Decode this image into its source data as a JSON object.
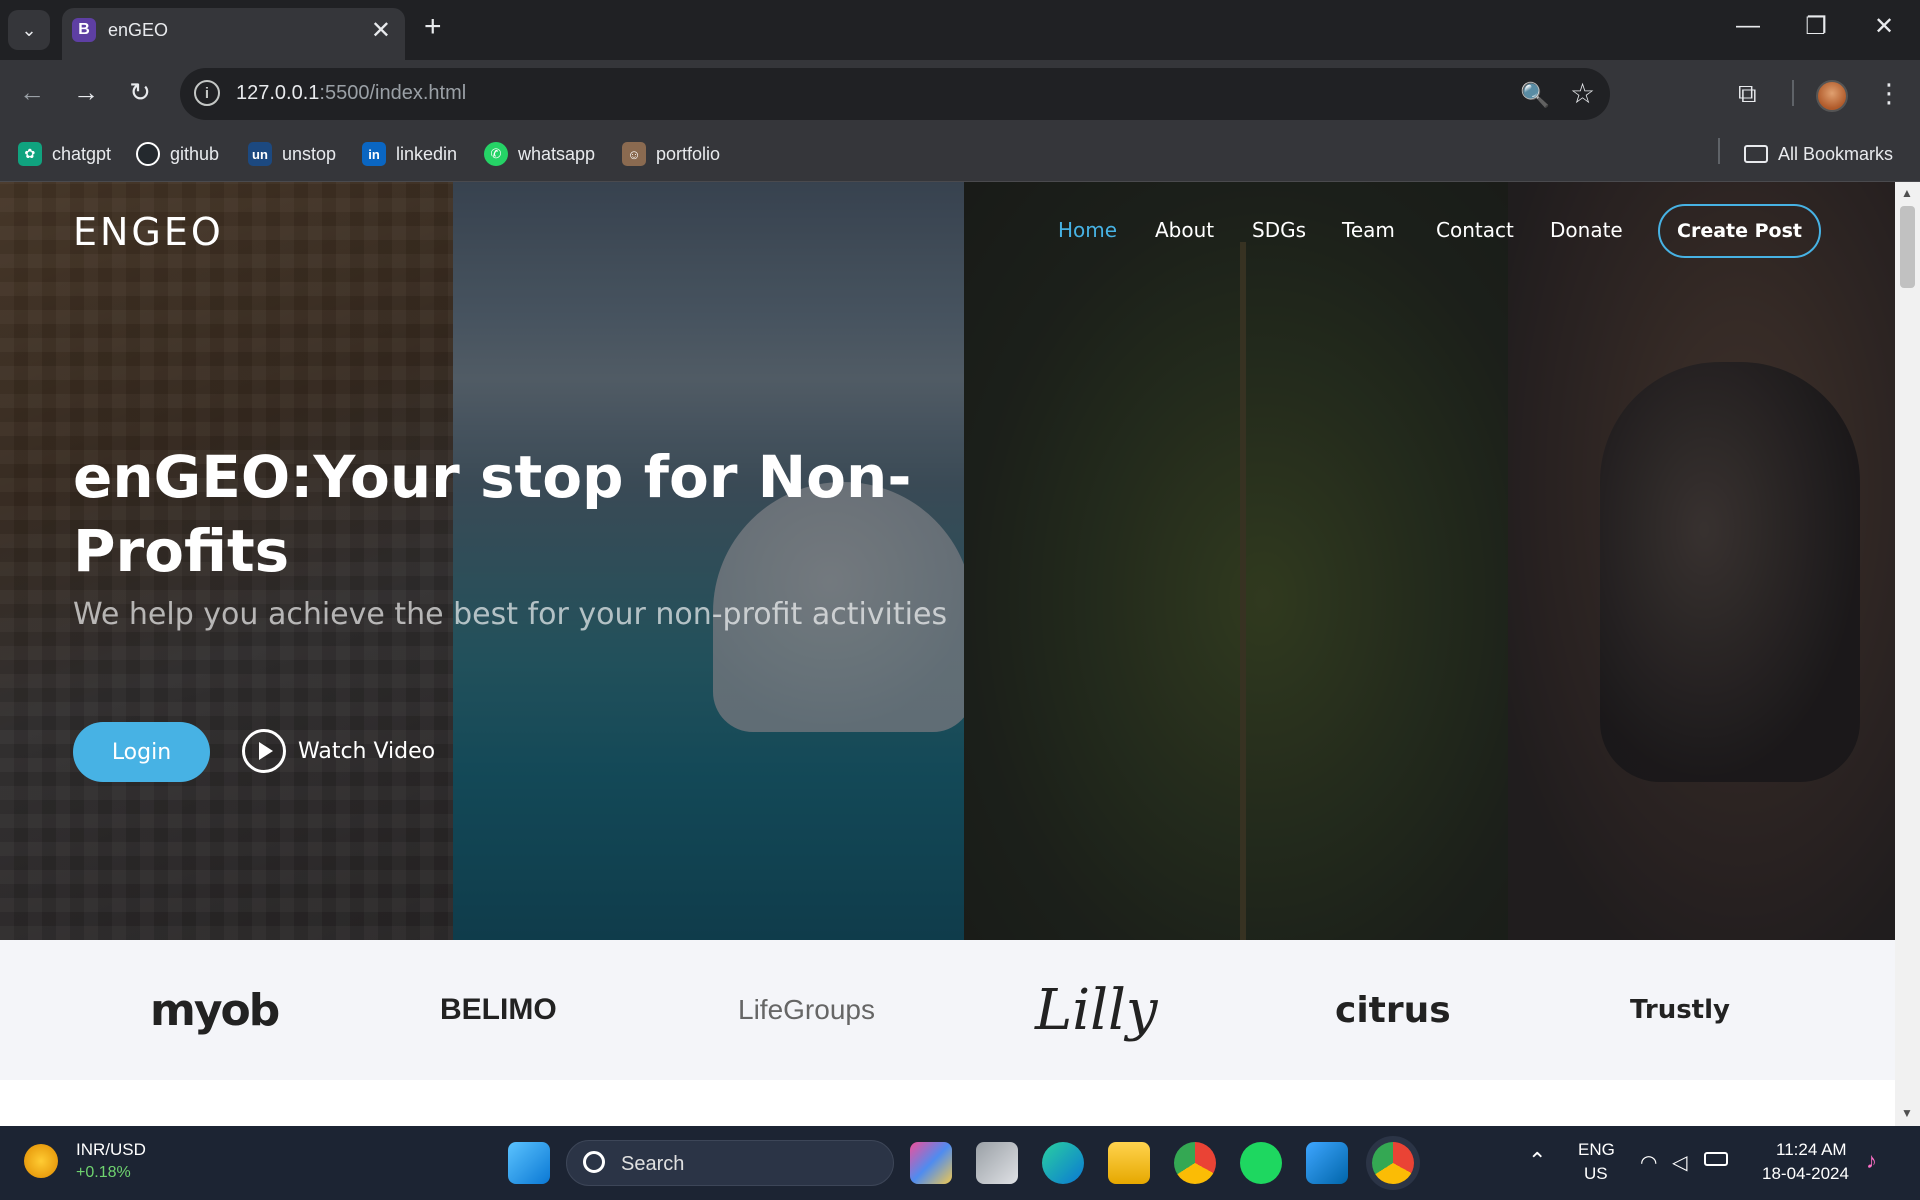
{
  "browser": {
    "tab": {
      "favicon": "B",
      "title": "enGEO",
      "close": "✕"
    },
    "new_tab": "+",
    "window_controls": {
      "minimize": "—",
      "restore": "❐",
      "close": "✕"
    },
    "nav": {
      "back": "←",
      "forward": "→",
      "reload": "↻"
    },
    "url_host": "127.0.0.1",
    "url_path": ":5500/index.html",
    "omnibox_right": {
      "zoom": "🔍",
      "star": "☆"
    },
    "toolbar_right": {
      "extensions": "⧉",
      "menu": "⋮"
    },
    "bookmarks": [
      {
        "label": "chatgpt",
        "icon": "chatgpt-icon",
        "glyph": "✿",
        "color": "#10a37f"
      },
      {
        "label": "github",
        "icon": "github-icon",
        "glyph": "●",
        "color": "#24292e"
      },
      {
        "label": "unstop",
        "icon": "unstop-icon",
        "glyph": "un",
        "color": "#1c4980"
      },
      {
        "label": "linkedin",
        "icon": "linkedin-icon",
        "glyph": "in",
        "color": "#0a66c2"
      },
      {
        "label": "whatsapp",
        "icon": "whatsapp-icon",
        "glyph": "✆",
        "color": "#25d366"
      },
      {
        "label": "portfolio",
        "icon": "portfolio-icon",
        "glyph": "☺",
        "color": "#8a6a50"
      }
    ],
    "all_bookmarks": "All Bookmarks"
  },
  "site": {
    "brand": "ENGEO",
    "nav": [
      "Home",
      "About",
      "SDGs",
      "Team",
      "Contact",
      "Donate"
    ],
    "active_nav": "Home",
    "cta": "Create Post",
    "hero": {
      "title": "enGEO:Your stop for Non-Profits",
      "subtitle": "We help you achieve the best for your non-profit activities",
      "login": "Login",
      "watch_video": "Watch Video"
    },
    "clients": [
      "myob",
      "BELIMO",
      "LifeGroups",
      "Lilly",
      "citrus",
      "Trustly"
    ],
    "accent": "#47b2e4"
  },
  "taskbar": {
    "ticker": {
      "pair": "INR/USD",
      "change": "+0.18%"
    },
    "search": "Search",
    "tray": {
      "lang": "ENG",
      "region": "US",
      "time": "11:24 AM",
      "date": "18-04-2024"
    }
  }
}
